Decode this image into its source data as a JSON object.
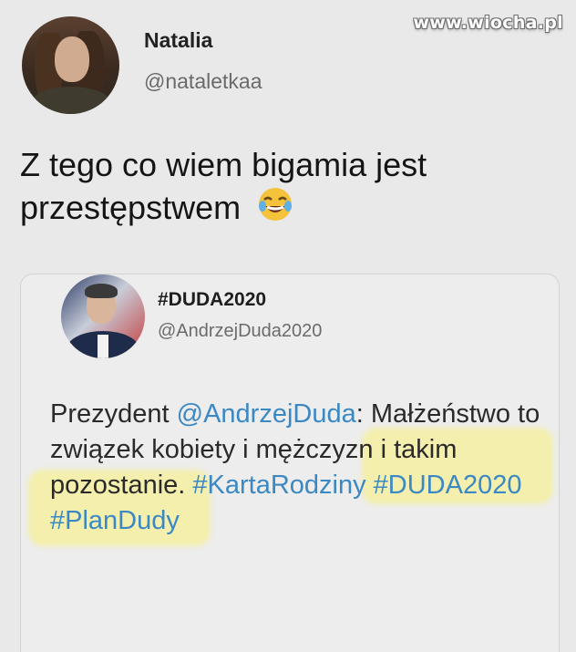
{
  "watermark": "www.wiocha.pl",
  "tweet": {
    "author_name": "Natalia",
    "author_handle": "@nataletkaa",
    "text": "Z tego co wiem bigamia jest przestępstwem",
    "emoji": "face-with-tears-of-joy"
  },
  "quoted_tweet": {
    "author_name": "#DUDA2020",
    "author_handle": "@AndrzejDuda2020",
    "text_prefix": "Prezydent ",
    "mention": "@AndrzejDuda",
    "text_body": ": Małżeństwo to związek kobiety i mężczyzn i takim pozostanie. ",
    "hashtags": [
      "#KartaRodziny",
      "#DUDA2020",
      "#PlanDudy"
    ]
  },
  "colors": {
    "background": "#e9e9e9",
    "link": "#3b88c3",
    "highlight": "#faf078"
  }
}
